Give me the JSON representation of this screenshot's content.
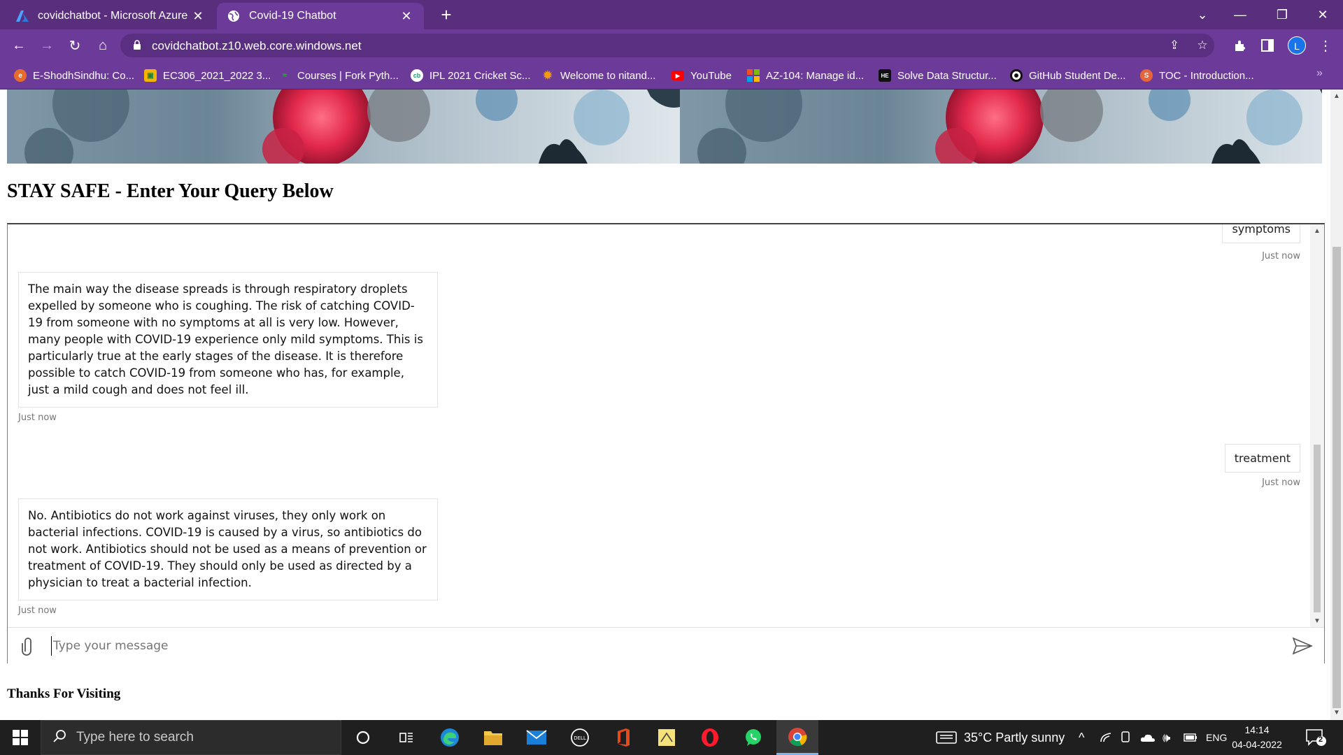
{
  "browser": {
    "tabs": [
      {
        "title": "covidchatbot - Microsoft Azure",
        "active": false
      },
      {
        "title": "Covid-19 Chatbot",
        "active": true
      }
    ],
    "url": "covidchatbot.z10.web.core.windows.net",
    "profile_initial": "L",
    "bookmarks": [
      {
        "label": "E-ShodhSindhu: Co...",
        "icon": "eshodh-icon"
      },
      {
        "label": "EC306_2021_2022 3...",
        "icon": "classroom-icon"
      },
      {
        "label": "Courses | Fork Pyth...",
        "icon": "forkpython-icon"
      },
      {
        "label": "IPL 2021 Cricket Sc...",
        "icon": "cricbuzz-icon"
      },
      {
        "label": "Welcome to nitand...",
        "icon": "nitand-icon"
      },
      {
        "label": "YouTube",
        "icon": "youtube-icon"
      },
      {
        "label": "AZ-104: Manage id...",
        "icon": "microsoft-icon"
      },
      {
        "label": "Solve Data Structur...",
        "icon": "hackerearth-icon"
      },
      {
        "label": "GitHub Student De...",
        "icon": "github-icon"
      },
      {
        "label": "TOC - Introduction...",
        "icon": "toc-icon"
      }
    ]
  },
  "page": {
    "heading": "STAY SAFE - Enter Your Query Below",
    "footer": "Thanks For Visiting"
  },
  "chat": {
    "messages": [
      {
        "from": "user",
        "text": "symptoms",
        "time": "Just now"
      },
      {
        "from": "bot",
        "text": "The main way the disease spreads is through respiratory droplets expelled by someone who is coughing. The risk of catching COVID-19 from someone with no symptoms at all is very low. However, many people with COVID-19 experience only mild symptoms. This is particularly true at the early stages of the disease. It is therefore possible to catch COVID-19 from someone who has, for example, just a mild cough and does not feel ill.",
        "time": "Just now"
      },
      {
        "from": "user",
        "text": "treatment",
        "time": "Just now"
      },
      {
        "from": "bot",
        "text": "No. Antibiotics do not work against viruses, they only work on bacterial infections. COVID-19 is caused by a virus, so antibiotics do not work. Antibiotics should not be used as a means of prevention or treatment of COVID-19. They should only be used as directed by a physician to treat a bacterial infection.",
        "time": "Just now"
      }
    ],
    "input_placeholder": "Type your message"
  },
  "taskbar": {
    "search_placeholder": "Type here to search",
    "weather": "35°C  Partly sunny",
    "language": "ENG",
    "time": "14:14",
    "date": "04-04-2022",
    "notification_count": "2"
  },
  "colors": {
    "browser_frame": "#582e7d",
    "browser_toolbar": "#6c3b99",
    "taskbar": "#1f1f1f"
  }
}
